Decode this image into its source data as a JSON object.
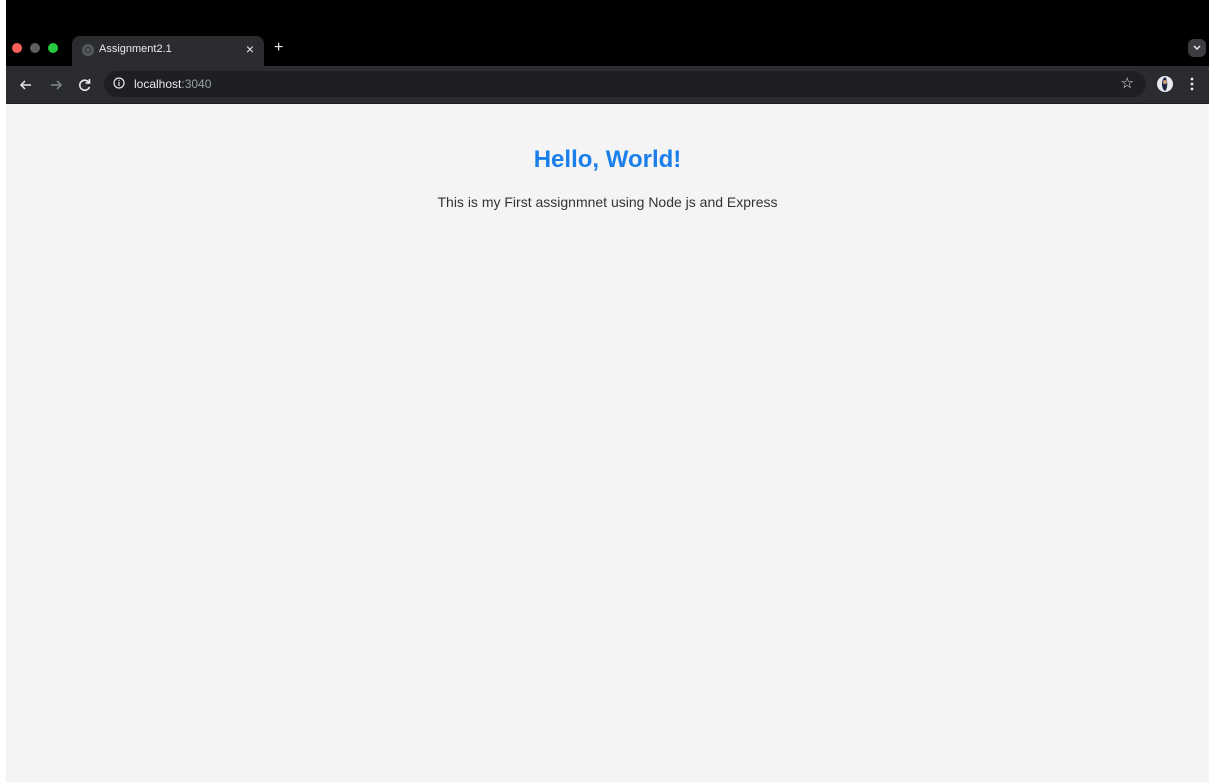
{
  "browser": {
    "tab": {
      "title": "Assignment2.1",
      "close_label": "×"
    },
    "new_tab_label": "+",
    "address": {
      "host": "localhost",
      "port": ":3040"
    },
    "bookmark_label": "☆",
    "colors": {
      "close": "#ff5f57",
      "minimize": "#5f5f5f",
      "maximize": "#28c840",
      "chrome_dark": "#000000",
      "toolbar": "#2b2c2f"
    }
  },
  "page": {
    "heading": "Hello, World!",
    "paragraph": "This is my First assignmnet using Node js and Express",
    "colors": {
      "heading": "#1a7fea",
      "text": "#333333",
      "background": "#f4f4f4"
    }
  }
}
